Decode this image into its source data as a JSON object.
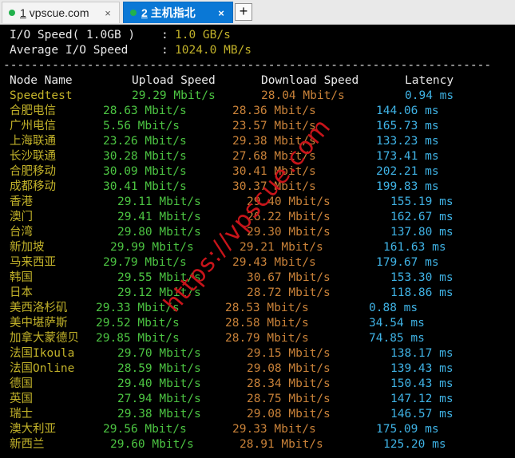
{
  "tabs": [
    {
      "number": "1",
      "title": "vpscue.com",
      "close": "×",
      "active": false
    },
    {
      "number": "2",
      "title": "主机指北",
      "close": "×",
      "active": true
    }
  ],
  "new_tab_label": "+",
  "io": {
    "speed_label": "I/O Speed( 1.0GB )",
    "speed_sep": ":",
    "speed_value": "1.0 GB/s",
    "avg_label": "Average I/O Speed",
    "avg_sep": ":",
    "avg_value": "1024.0 MB/s"
  },
  "separator": "----------------------------------------------------------------------",
  "headers": {
    "node": "Node Name",
    "upload": "Upload Speed",
    "download": "Download Speed",
    "latency": "Latency"
  },
  "rows": [
    {
      "node": "Speedtest",
      "upload": "29.29 Mbit/s",
      "download": "28.04 Mbit/s",
      "latency": "0.94 ms"
    },
    {
      "node": "合肥电信",
      "upload": "28.63 Mbit/s",
      "download": "28.36 Mbit/s",
      "latency": "144.06 ms"
    },
    {
      "node": "广州电信",
      "upload": "5.56 Mbit/s",
      "download": "23.57 Mbit/s",
      "latency": "165.73 ms"
    },
    {
      "node": "上海联通",
      "upload": "23.26 Mbit/s",
      "download": "29.38 Mbit/s",
      "latency": "133.23 ms"
    },
    {
      "node": "长沙联通",
      "upload": "30.28 Mbit/s",
      "download": "27.68 Mbit/s",
      "latency": "173.41 ms"
    },
    {
      "node": "合肥移动",
      "upload": "30.09 Mbit/s",
      "download": "30.41 Mbit/s",
      "latency": "202.21 ms"
    },
    {
      "node": "成都移动",
      "upload": "30.41 Mbit/s",
      "download": "30.37 Mbit/s",
      "latency": "199.83 ms"
    },
    {
      "node": "香港",
      "upload": "29.11 Mbit/s",
      "download": "29.40 Mbit/s",
      "latency": "155.19 ms"
    },
    {
      "node": "澳门",
      "upload": "29.41 Mbit/s",
      "download": "26.22 Mbit/s",
      "latency": "162.67 ms"
    },
    {
      "node": "台湾",
      "upload": "29.80 Mbit/s",
      "download": "29.30 Mbit/s",
      "latency": "137.80 ms"
    },
    {
      "node": "新加坡",
      "upload": "29.99 Mbit/s",
      "download": "29.21 Mbit/s",
      "latency": "161.63 ms"
    },
    {
      "node": "马来西亚",
      "upload": "29.79 Mbit/s",
      "download": "29.43 Mbit/s",
      "latency": "179.67 ms"
    },
    {
      "node": "韩国",
      "upload": "29.55 Mbit/s",
      "download": "30.67 Mbit/s",
      "latency": "153.30 ms"
    },
    {
      "node": "日本",
      "upload": "29.12 Mbit/s",
      "download": "28.72 Mbit/s",
      "latency": "118.86 ms"
    },
    {
      "node": "美西洛杉矶",
      "upload": "29.33 Mbit/s",
      "download": "28.53 Mbit/s",
      "latency": "0.88 ms"
    },
    {
      "node": "美中堪萨斯",
      "upload": "29.52 Mbit/s",
      "download": "28.58 Mbit/s",
      "latency": "34.54 ms"
    },
    {
      "node": "加拿大蒙德贝",
      "upload": "29.85 Mbit/s",
      "download": "28.79 Mbit/s",
      "latency": "74.85 ms"
    },
    {
      "node": "法国Ikoula",
      "upload": "29.70 Mbit/s",
      "download": "29.15 Mbit/s",
      "latency": "138.17 ms"
    },
    {
      "node": "法国Online",
      "upload": "28.59 Mbit/s",
      "download": "29.08 Mbit/s",
      "latency": "139.43 ms"
    },
    {
      "node": "德国",
      "upload": "29.40 Mbit/s",
      "download": "28.34 Mbit/s",
      "latency": "150.43 ms"
    },
    {
      "node": "英国",
      "upload": "27.94 Mbit/s",
      "download": "28.75 Mbit/s",
      "latency": "147.12 ms"
    },
    {
      "node": "瑞士",
      "upload": "29.38 Mbit/s",
      "download": "29.08 Mbit/s",
      "latency": "146.57 ms"
    },
    {
      "node": "澳大利亚",
      "upload": "29.56 Mbit/s",
      "download": "29.33 Mbit/s",
      "latency": "175.09 ms"
    },
    {
      "node": "新西兰",
      "upload": "29.60 Mbit/s",
      "download": "28.91 Mbit/s",
      "latency": "125.20 ms"
    }
  ],
  "watermark": "https://vpscue.com",
  "colors": {
    "label": "#e8e8e8",
    "value": "#c2b22a",
    "upload": "#4cc442",
    "download": "#c98239",
    "latency": "#3fb2e4",
    "tab_active": "#0a78d6",
    "watermark": "#c8141a"
  }
}
